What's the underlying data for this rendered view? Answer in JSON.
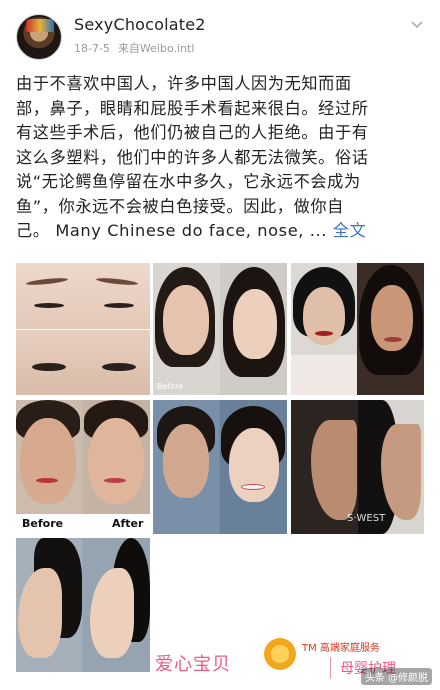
{
  "header": {
    "username": "SexyChocolate2",
    "date": "18-7-5",
    "source": "来自Weibo.intl"
  },
  "post": {
    "lines": [
      "由于不喜欢中国人，许多中国人因为无知而面",
      "部，鼻子，眼睛和屁股手术看起来很白。经过所",
      "有这些手术后，他们仍被自己的人拒绝。由于有",
      "这么多塑料，他们中的许多人都无法微笑。俗话",
      "说“无论鳄鱼停留在水中多久，它永远不会成为",
      "鱼”，你永远不会被白色接受。因此，做你自"
    ],
    "last_line": "己。 Many Chinese do face, nose, ...",
    "full_link": "全文"
  },
  "photos": {
    "before_label": "Before",
    "after_label": "After",
    "small_before": "Before",
    "watermark": "S·WEST"
  },
  "footer": {
    "brand": "爱心宝贝",
    "tm": "TM 高端家庭服务",
    "care": "母婴护理",
    "source": "头条 @修颜脱"
  },
  "colors": {
    "link": "#3f72c6",
    "brand_pink": "#ec5a86"
  }
}
